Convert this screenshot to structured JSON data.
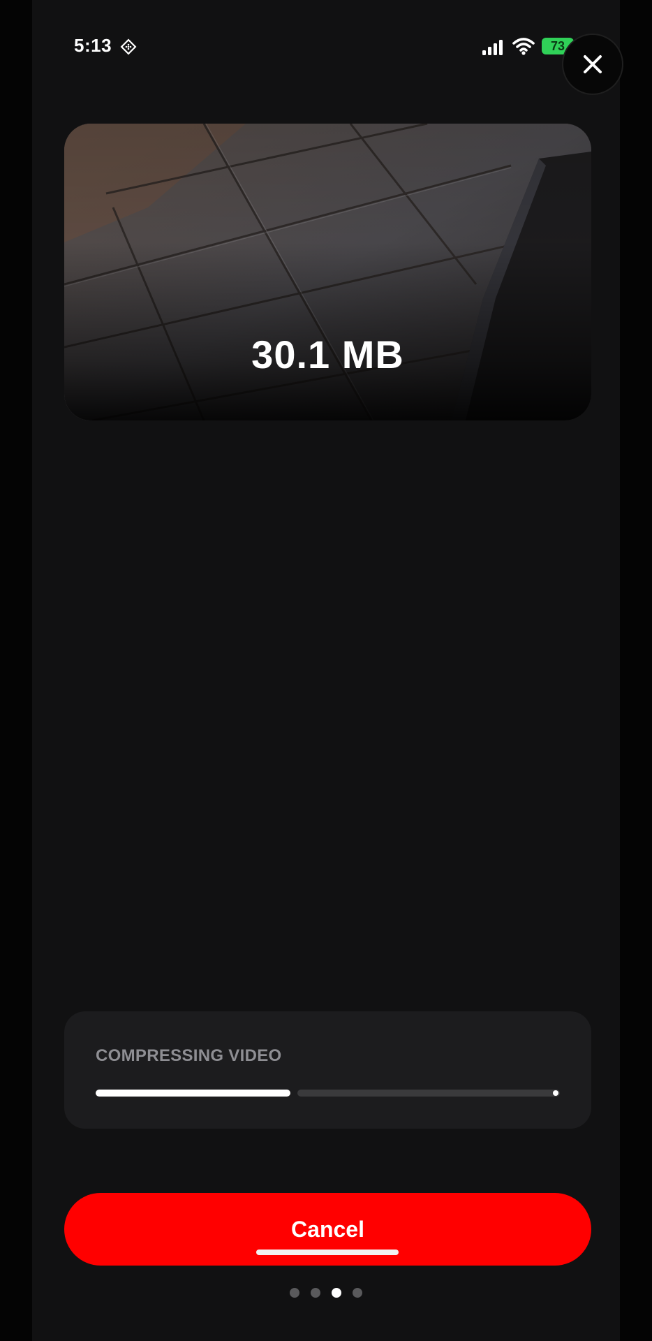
{
  "status_bar": {
    "time": "5:13",
    "battery_level": "73",
    "icons": [
      "focus-icon",
      "cellular-signal-icon",
      "wifi-icon",
      "battery-icon",
      "charging-bolt-icon"
    ]
  },
  "close_button": {
    "icon": "close-icon"
  },
  "preview": {
    "file_size": "30.1 MB"
  },
  "progress": {
    "label": "COMPRESSING VIDEO",
    "fraction": 0.42
  },
  "cancel_button": {
    "label": "Cancel"
  },
  "pager": {
    "count": 4,
    "active_index": 2
  },
  "colors": {
    "background": "#111112",
    "card": "#1c1c1e",
    "accent": "#ff0000",
    "battery": "#30d158"
  }
}
